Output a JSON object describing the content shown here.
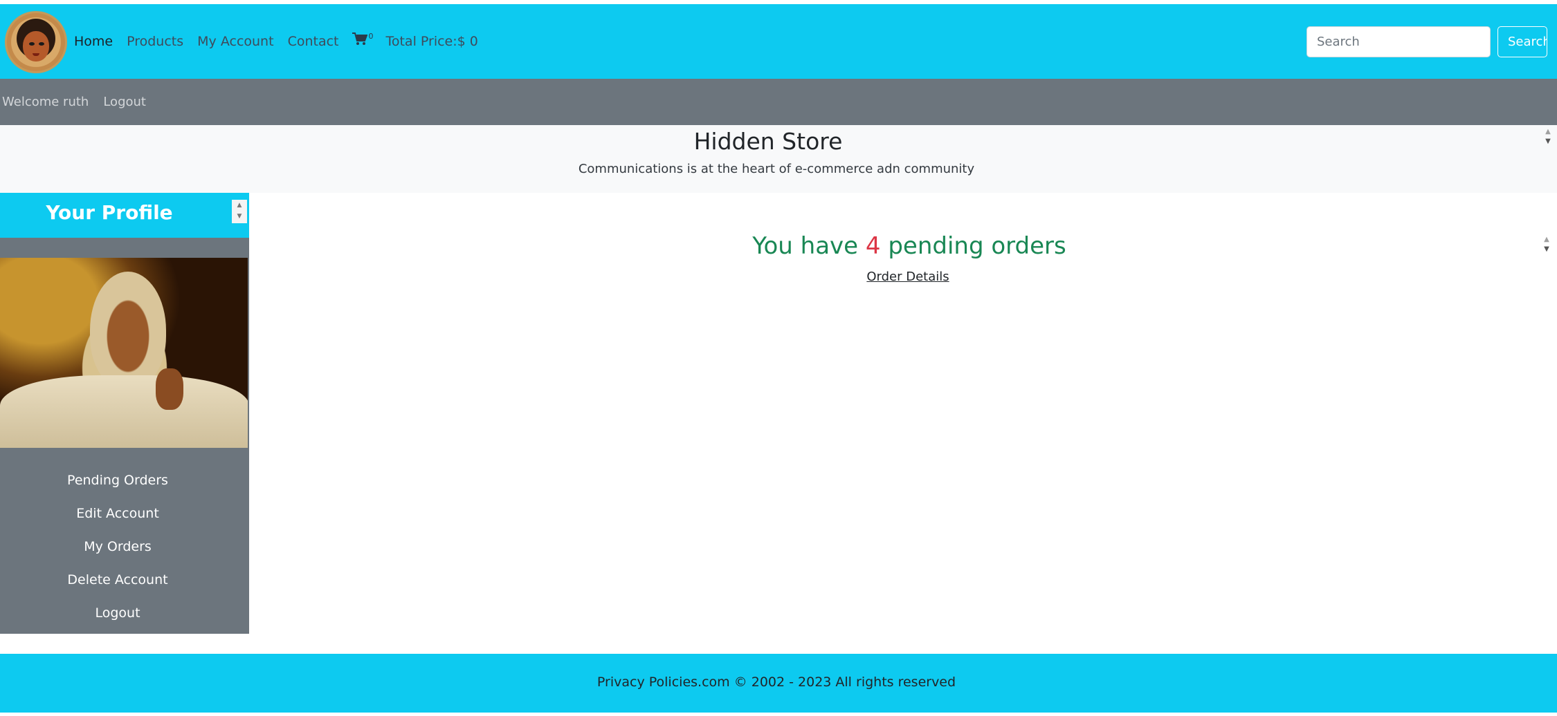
{
  "nav": {
    "links": [
      "Home",
      "Products",
      "My Account",
      "Contact"
    ],
    "cart_count": "0",
    "total_price": "Total Price:$ 0",
    "search_placeholder": "Search",
    "search_button": "Search"
  },
  "welcome": {
    "greeting": "Welcome ruth",
    "logout": "Logout"
  },
  "header": {
    "title": "Hidden Store",
    "subtitle": "Communications is at the heart of e-commerce adn community"
  },
  "sidebar": {
    "title": "Your Profile",
    "items": [
      "Pending Orders",
      "Edit Account",
      "My Orders",
      "Delete Account",
      "Logout"
    ]
  },
  "main": {
    "pending_prefix": "You have ",
    "pending_count": "4",
    "pending_suffix": " pending orders",
    "order_details": "Order Details"
  },
  "footer": {
    "text": "Privacy Policies.com © 2002 - 2023 All rights reserved"
  },
  "colors": {
    "accent": "#0dcaf0",
    "secondary": "#6c757d",
    "success": "#198754",
    "danger": "#dc3545"
  }
}
